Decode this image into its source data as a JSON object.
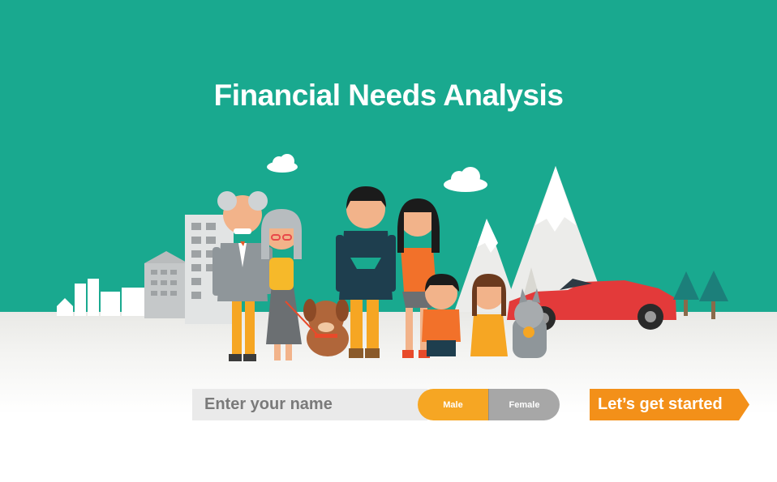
{
  "page": {
    "title": "Financial Needs Analysis"
  },
  "form": {
    "name_placeholder": "Enter your name",
    "gender_options": [
      "Male",
      "Female"
    ],
    "selected_gender": "Male",
    "start_label": "Let’s get started"
  },
  "colors": {
    "background": "#19a98f",
    "accent": "#f6a623",
    "cta": "#f39019",
    "inactive": "#a7a7a7"
  }
}
